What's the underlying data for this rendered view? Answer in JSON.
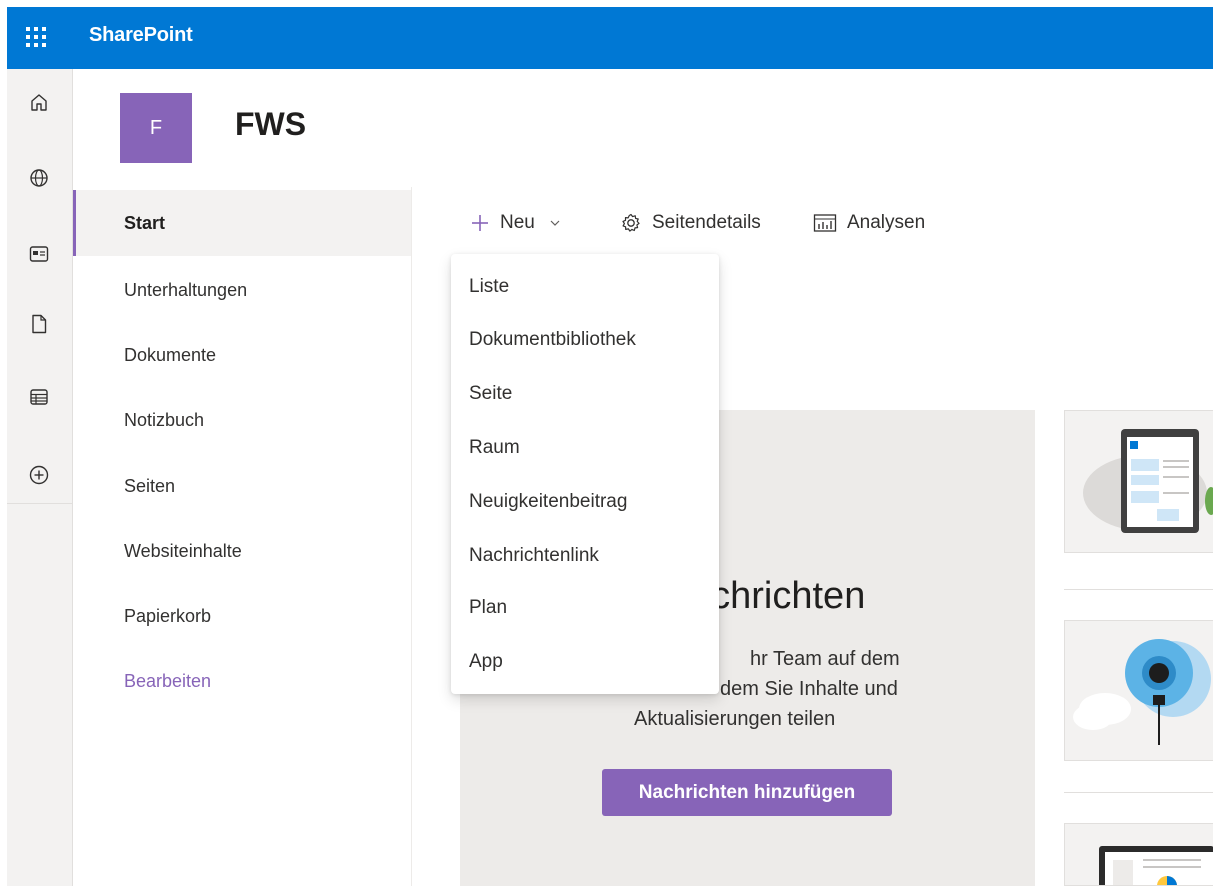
{
  "suitebar": {
    "brand": "SharePoint",
    "bg_color": "#0078d4"
  },
  "appbar": {
    "icons": [
      "home-icon",
      "globe-icon",
      "news-icon",
      "file-icon",
      "list-icon",
      "add-icon"
    ]
  },
  "site": {
    "logo_letter": "F",
    "title": "FWS",
    "accent_color": "#8764b8"
  },
  "leftnav": {
    "items": [
      {
        "label": "Start",
        "active": true
      },
      {
        "label": "Unterhaltungen"
      },
      {
        "label": "Dokumente"
      },
      {
        "label": "Notizbuch"
      },
      {
        "label": "Seiten"
      },
      {
        "label": "Websiteinhalte"
      },
      {
        "label": "Papierkorb"
      }
    ],
    "edit_label": "Bearbeiten"
  },
  "commandbar": {
    "new_label": "Neu",
    "page_details_label": "Seitendetails",
    "analytics_label": "Analysen"
  },
  "new_menu": {
    "items": [
      "Liste",
      "Dokumentbibliothek",
      "Seite",
      "Raum",
      "Neuigkeitenbeitrag",
      "Nachrichtenlink",
      "Plan",
      "App"
    ]
  },
  "news": {
    "heading_visible": "achrichten",
    "desc_line1": "hr Team auf dem",
    "desc_line2": "dem Sie Inhalte und",
    "desc_line3": "Aktualisierungen teilen",
    "button_label": "Nachrichten hinzufügen"
  }
}
